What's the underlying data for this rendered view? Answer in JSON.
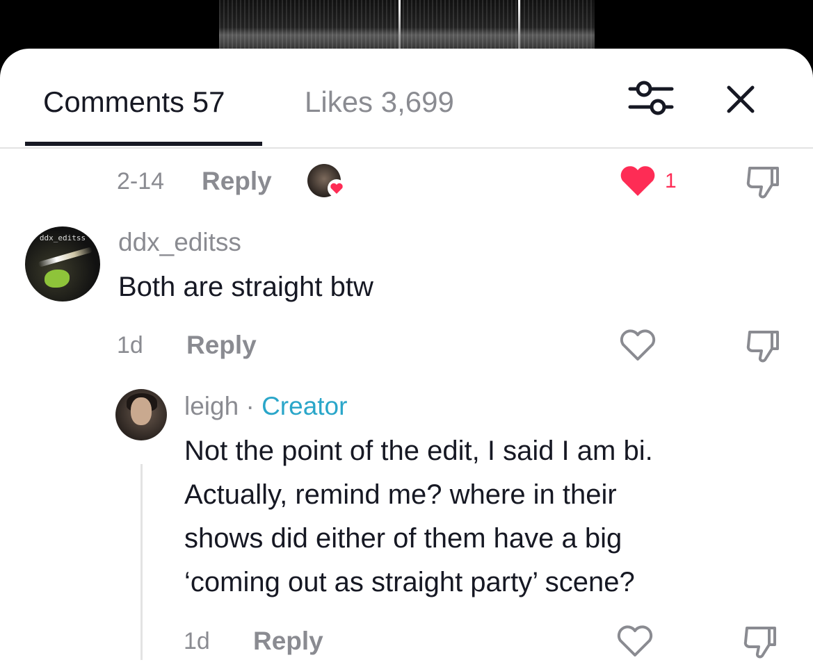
{
  "tabs": {
    "comments_label": "Comments 57",
    "likes_label": "Likes 3,699"
  },
  "icons": {
    "filter": "sliders-icon",
    "close": "close-icon",
    "heart": "heart-icon",
    "dislike": "thumbs-down-icon"
  },
  "colors": {
    "accent_like": "#fe2c55",
    "creator_badge": "#2aa6c9",
    "text_primary": "#161823",
    "text_secondary": "#8a8b91"
  },
  "previous_comment": {
    "time": "2-14",
    "reply_label": "Reply",
    "like_count": "1",
    "liked": true
  },
  "comment1": {
    "avatar_text": "ddx_editss",
    "username": "ddx_editss",
    "text": "Both are straight btw",
    "time": "1d",
    "reply_label": "Reply"
  },
  "reply1": {
    "username": "leigh",
    "separator": "·",
    "badge": "Creator",
    "text_lines": [
      "Not the point of the edit, I said I am bi.",
      "Actually, remind me? where in their",
      "shows did either of them have a big",
      "‘coming out as straight party’ scene?"
    ],
    "time": "1d",
    "reply_label": "Reply"
  }
}
